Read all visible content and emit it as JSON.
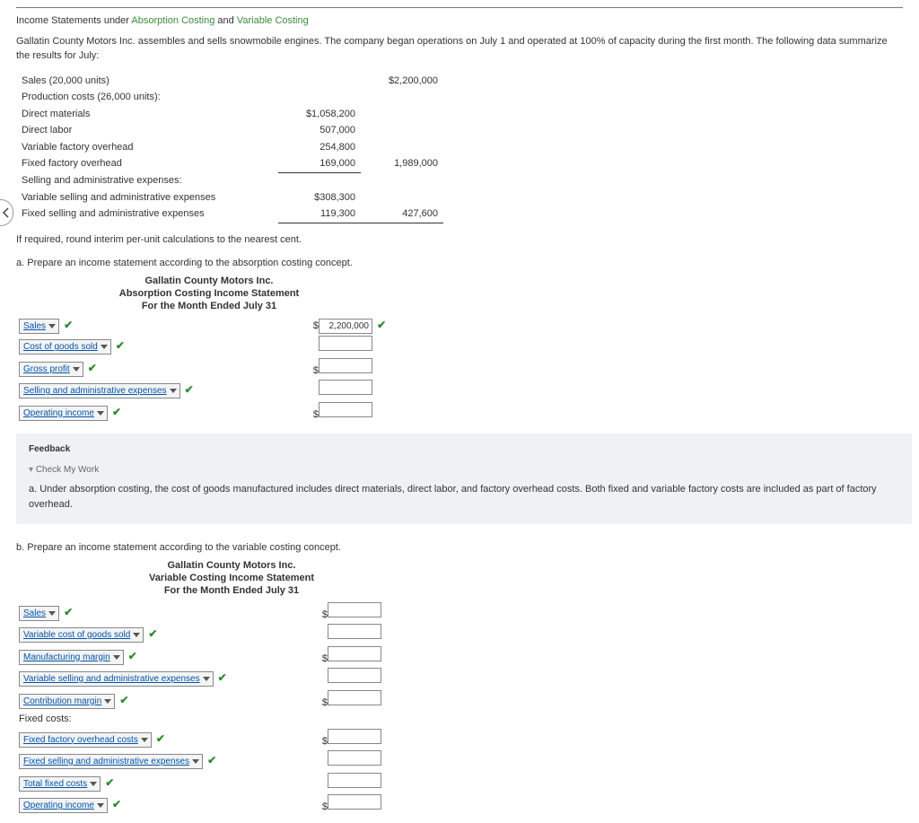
{
  "heading": {
    "prefix": "Income Statements under ",
    "abs": "Absorption Costing",
    "mid": " and ",
    "var": "Variable Costing"
  },
  "intro": "Gallatin County Motors Inc. assembles and sells snowmobile engines. The company began operations on July 1 and operated at 100% of capacity during the first month. The following data summarize the results for July:",
  "facts": {
    "sales_label": "Sales (20,000 units)",
    "sales_value": "$2,200,000",
    "prod_label": "Production costs (26,000 units):",
    "dm_label": "Direct materials",
    "dm_val": "$1,058,200",
    "dl_label": "Direct labor",
    "dl_val": "507,000",
    "vfo_label": "Variable factory overhead",
    "vfo_val": "254,800",
    "ffo_label": "Fixed factory overhead",
    "ffo_val": "169,000",
    "prod_total": "1,989,000",
    "sae_label": "Selling and administrative expenses:",
    "vsae_label": "Variable selling and administrative expenses",
    "vsae_val": "$308,300",
    "fsae_label": "Fixed selling and administrative expenses",
    "fsae_val": "119,300",
    "sae_total": "427,600"
  },
  "note": "If required, round interim per-unit calculations to the nearest cent.",
  "partA": {
    "letter": "a.",
    "prompt": "Prepare an income statement according to the absorption costing concept.",
    "h1": "Gallatin County Motors Inc.",
    "h2": "Absorption Costing Income Statement",
    "h3": "For the Month Ended July 31",
    "rows": {
      "sales": "Sales",
      "cogs": "Cost of goods sold",
      "gp": "Gross profit",
      "sae": "Selling and administrative expenses",
      "oi": "Operating income"
    },
    "sales_input": "2,200,000"
  },
  "feedback": {
    "title": "Feedback",
    "cmw": "Check My Work",
    "text": "a. Under absorption costing, the cost of goods manufactured includes direct materials, direct labor, and factory overhead costs. Both fixed and variable factory costs are included as part of factory overhead."
  },
  "partB": {
    "letter": "b.",
    "prompt": "Prepare an income statement according to the variable costing concept.",
    "h1": "Gallatin County Motors Inc.",
    "h2": "Variable Costing Income Statement",
    "h3": "For the Month Ended July 31",
    "rows": {
      "sales": "Sales",
      "vcgs": "Variable cost of goods sold",
      "mm": "Manufacturing margin",
      "vsae": "Variable selling and administrative expenses",
      "cm": "Contribution margin",
      "fc_label": "Fixed costs:",
      "ffo": "Fixed factory overhead costs",
      "fsae": "Fixed selling and administrative expenses",
      "tfc": "Total fixed costs",
      "oi": "Operating income"
    }
  }
}
